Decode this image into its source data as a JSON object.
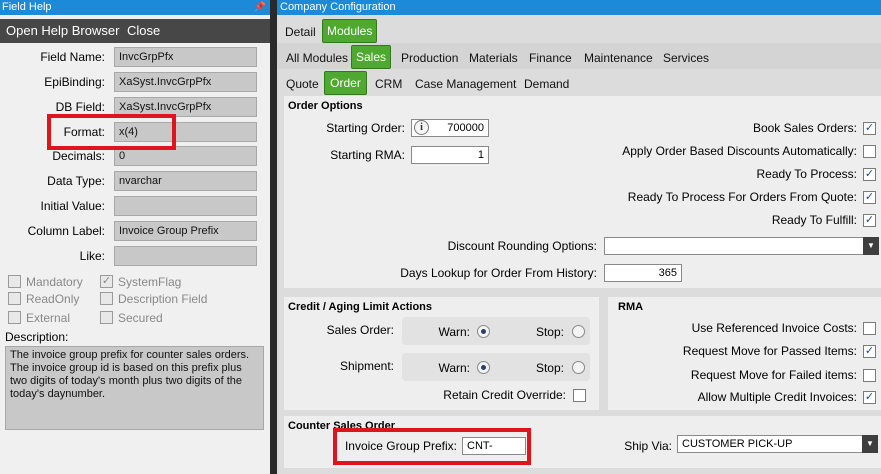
{
  "help": {
    "title": "Field Help",
    "pin_glyph": "📌",
    "open_browser": "Open Help Browser",
    "close": "Close",
    "fields": [
      {
        "label": "Field Name:",
        "value": "InvcGrpPfx"
      },
      {
        "label": "EpiBinding:",
        "value": "XaSyst.InvcGrpPfx"
      },
      {
        "label": "DB Field:",
        "value": "XaSyst.InvcGrpPfx"
      },
      {
        "label": "Format:",
        "value": "x(4)"
      },
      {
        "label": "Decimals:",
        "value": "0"
      },
      {
        "label": "Data Type:",
        "value": "nvarchar"
      },
      {
        "label": "Initial Value:",
        "value": ""
      },
      {
        "label": "Column Label:",
        "value": "Invoice Group Prefix"
      },
      {
        "label": "Like:",
        "value": ""
      }
    ],
    "flags": {
      "mandatory": "Mandatory",
      "systemflag": "SystemFlag",
      "readonly": "ReadOnly",
      "description_field": "Description Field",
      "external": "External",
      "secured": "Secured"
    },
    "description_label": "Description:",
    "description": "The invoice group prefix for counter sales orders. The invoice group id is based on this prefix plus two digits of today's month  plus two digits of the today's daynumber."
  },
  "config": {
    "title": "Company Configuration",
    "tabs_level1": [
      "Detail",
      "Modules"
    ],
    "tabs_level2": [
      "All Modules",
      "Sales",
      "Production",
      "Materials",
      "Finance",
      "Maintenance",
      "Services"
    ],
    "tabs_level3": [
      "Quote",
      "Order",
      "CRM",
      "Case Management",
      "Demand"
    ],
    "order_options": {
      "title": "Order Options",
      "starting_order_label": "Starting Order:",
      "starting_order_value": "700000",
      "starting_rma_label": "Starting RMA:",
      "starting_rma_value": "1",
      "book_sales_orders": "Book Sales Orders:",
      "apply_order_discounts": "Apply Order Based Discounts Automatically:",
      "ready_to_process": "Ready To Process:",
      "ready_to_process_quote": "Ready To Process For Orders From Quote:",
      "ready_to_fulfill": "Ready To Fulfill:",
      "discount_rounding_label": "Discount Rounding Options:",
      "discount_rounding_value": "",
      "days_lookup_label": "Days Lookup for Order From History:",
      "days_lookup_value": "365"
    },
    "credit": {
      "title": "Credit / Aging Limit Actions",
      "sales_order_label": "Sales Order:",
      "shipment_label": "Shipment:",
      "warn": "Warn:",
      "stop": "Stop:",
      "retain_override": "Retain Credit Override:"
    },
    "rma": {
      "title": "RMA",
      "use_ref_invoice_costs": "Use Referenced Invoice Costs:",
      "request_move_passed": "Request Move for Passed Items:",
      "request_move_failed": "Request Move for Failed items:",
      "allow_multiple_credit": "Allow Multiple Credit Invoices:"
    },
    "counter_sales": {
      "title": "Counter Sales Order",
      "invoice_prefix_label": "Invoice Group Prefix:",
      "invoice_prefix_value": "CNT-",
      "ship_via_label": "Ship Via:",
      "ship_via_value": "CUSTOMER PICK-UP"
    }
  },
  "glyphs": {
    "check": "✓",
    "dropdown": "▼",
    "info": "i"
  },
  "colors": {
    "title_bar": "#1c8ad8",
    "active_tab": "#4fa82f",
    "highlight": "#e0141e"
  }
}
